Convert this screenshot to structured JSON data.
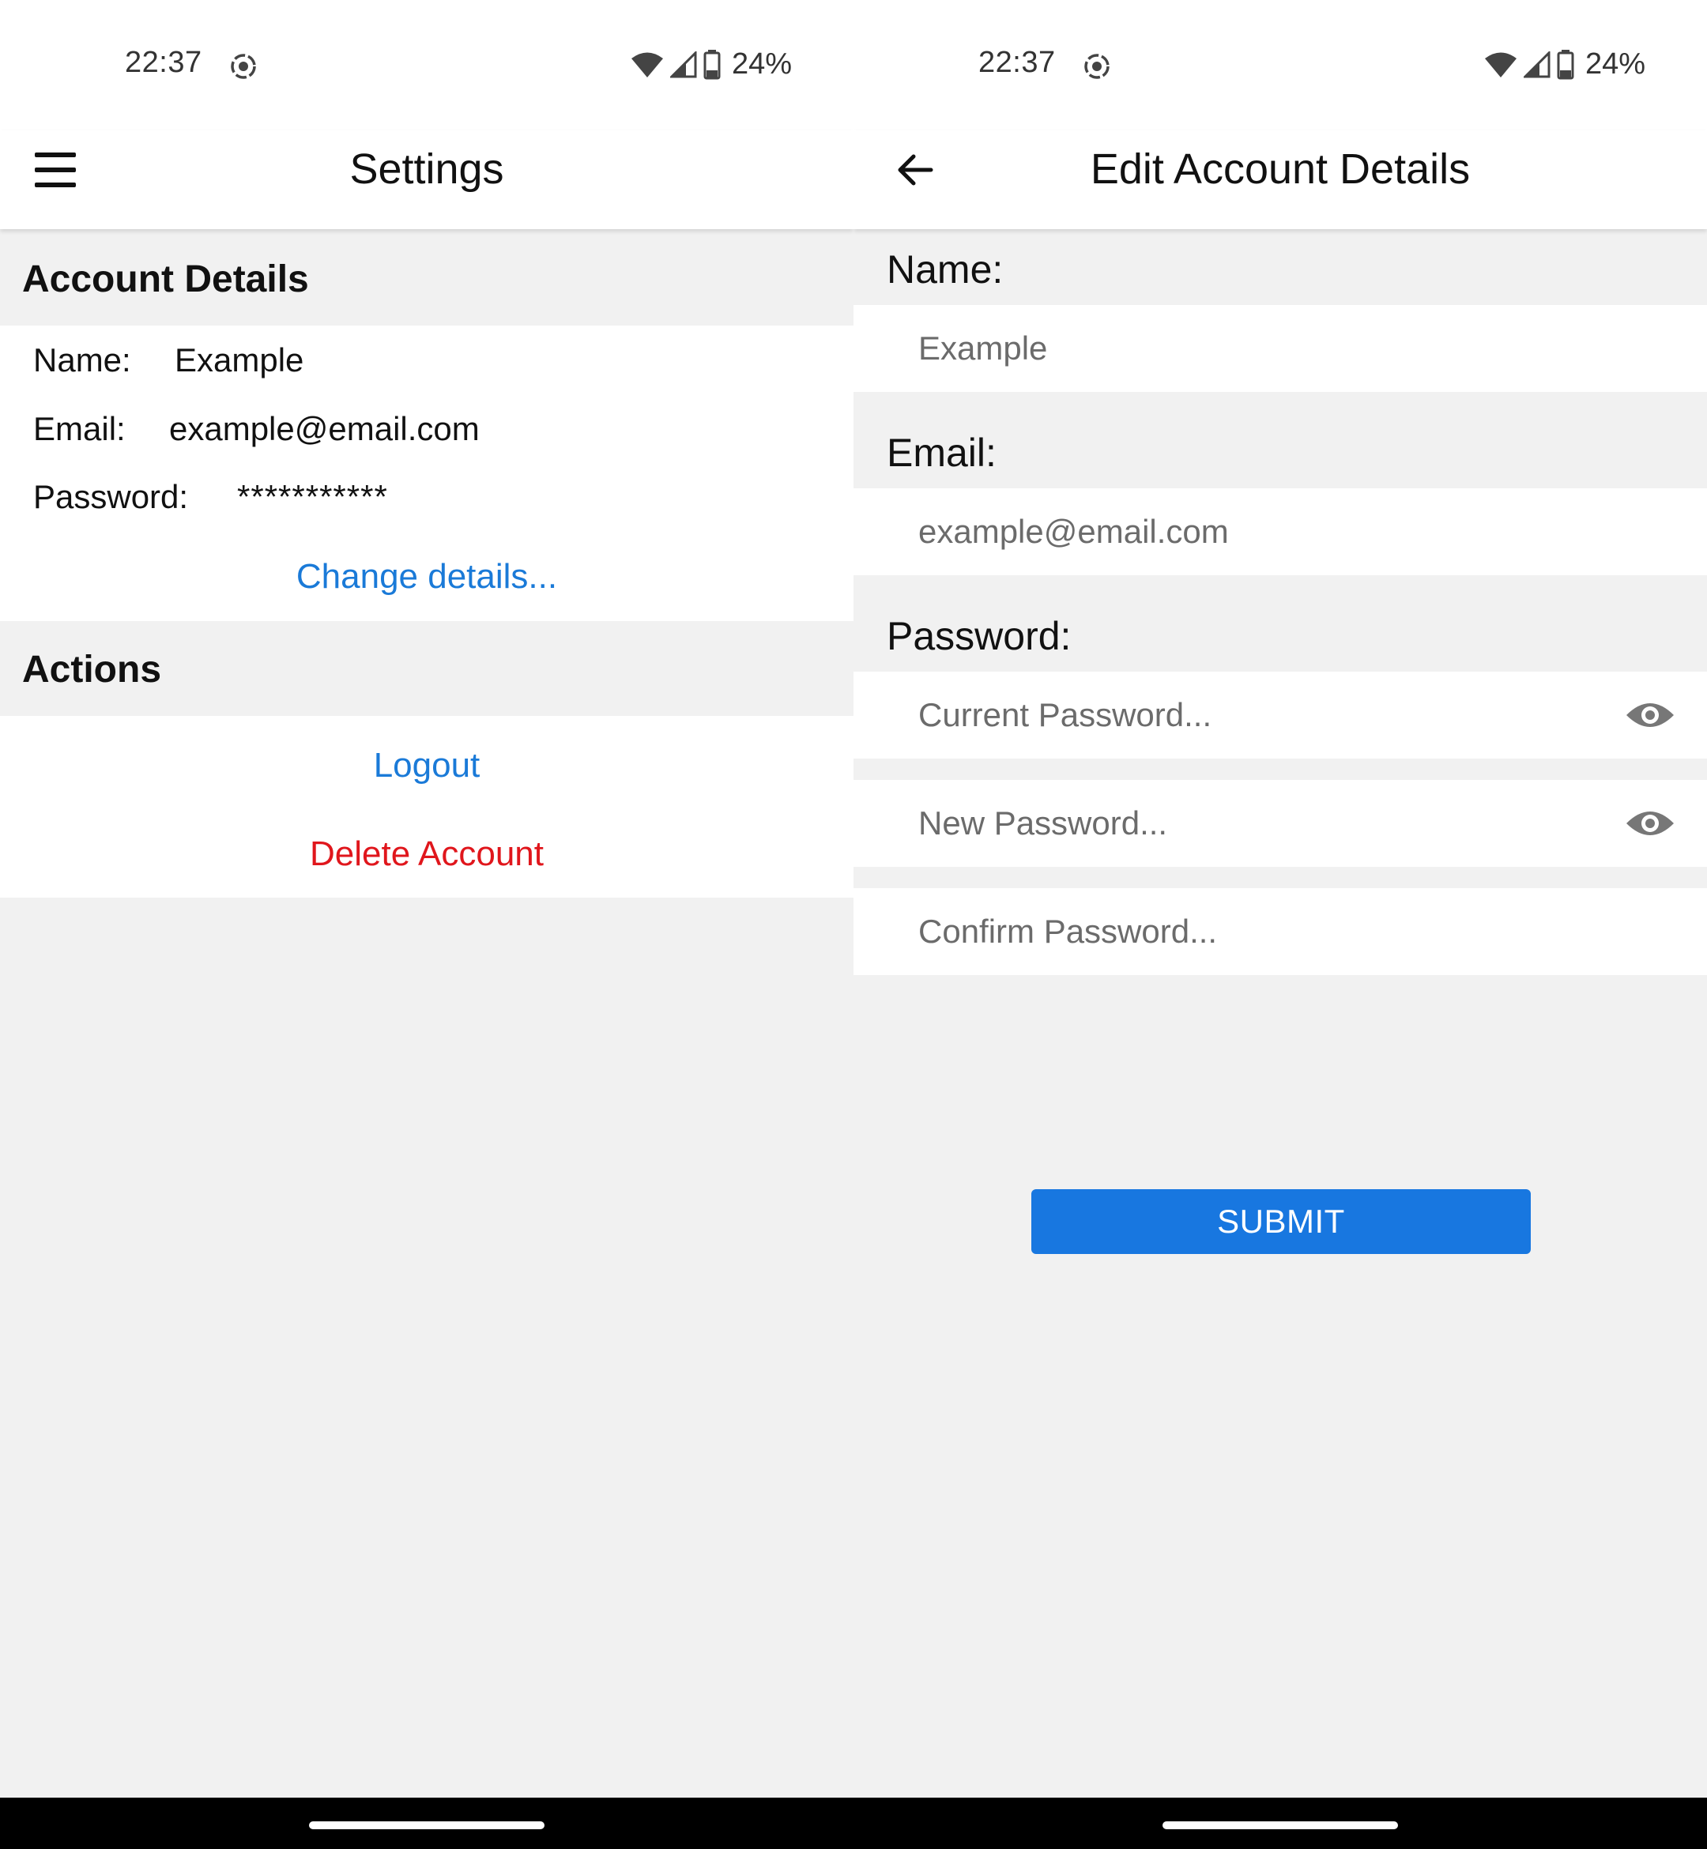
{
  "status_bar": {
    "time": "22:37",
    "battery_percent": "24%",
    "icons": [
      "screen-record-icon",
      "wifi-icon",
      "signal-icon",
      "battery-icon"
    ]
  },
  "settings_screen": {
    "title": "Settings",
    "nav_icon": "menu-icon",
    "account_details": {
      "header": "Account Details",
      "name_label": "Name:",
      "name_value": "Example",
      "email_label": "Email:",
      "email_value": "example@email.com",
      "password_label": "Password:",
      "password_value": "***********",
      "change_link": "Change details..."
    },
    "actions": {
      "header": "Actions",
      "logout": "Logout",
      "delete_account": "Delete Account"
    }
  },
  "edit_screen": {
    "title": "Edit Account Details",
    "nav_icon": "back-arrow-icon",
    "name_label": "Name:",
    "name_placeholder": "Example",
    "email_label": "Email:",
    "email_placeholder": "example@email.com",
    "password_label": "Password:",
    "current_password_placeholder": "Current Password...",
    "new_password_placeholder": "New Password...",
    "confirm_password_placeholder": "Confirm Password...",
    "submit_label": "SUBMIT"
  },
  "colors": {
    "link_blue": "#1a7ad8",
    "danger_red": "#e0161c",
    "button_blue": "#1877e0",
    "background": "#f1f1f1"
  }
}
